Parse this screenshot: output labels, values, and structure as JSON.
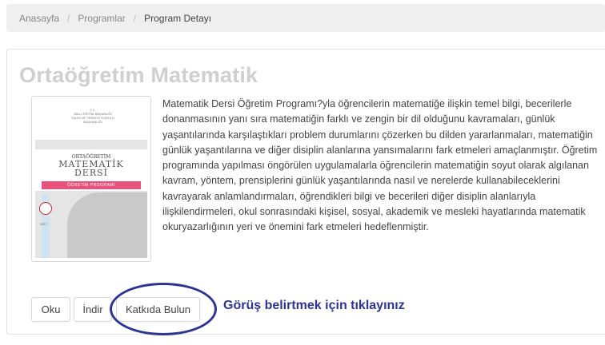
{
  "breadcrumb": {
    "items": [
      "Anasayfa",
      "Programlar"
    ],
    "active": "Program Detayı",
    "separator": "/"
  },
  "program": {
    "title": "Ortaöğretim Matematik",
    "description": "Matematik Dersi Öğretim Programı?yla öğrencilerin matematiğe ilişkin temel bilgi, becerilerle donanmasının yanı sıra matematiğin farklı ve zengin bir dil olduğunu kavramaları, günlük yaşantılarında karşılaştıkları problem durumlarını çözerken bu dilden yararlanmaları, matematiğin günlük yaşantılarına ve diğer disiplin alanlarına yansımalarını fark etmeleri amaçlanmıştır. Öğretim programında yapılması öngörülen uygulamalarla öğrencilerin matematiğin soyut olarak algılanan kavram, yöntem, prensiplerini günlük yaşantılarında nasıl ve nerelerde kullanabileceklerini kavrayarak anlamlandırmaları, öğrendikleri bilgi ve becerileri diğer disiplin alanlarıyla ilişkilendirmeleri, okul sonrasındaki kişisel, sosyal, akademik ve mesleki hayatlarında matematik okuryazarlığının yeri ve önemini fark etmeleri hedeflenmiştir.",
    "cover": {
      "top_text": "T.C.\nMİLLİ EĞİTİM BAKANLIĞI\nTALİM VE TERBİYE KURULU BAŞKANLIĞI",
      "subtitle": "ORTAÖĞRETİM",
      "main_line1": "MATEMATİK",
      "main_line2": "DERSİ",
      "pill": "ÖĞRETİM PROGRAMI",
      "year": "2017"
    }
  },
  "actions": {
    "read": "Oku",
    "download": "İndir",
    "contribute": "Katkıda Bulun"
  },
  "annotation": {
    "hint": "Görüş belirtmek için tıklayınız",
    "color": "#2e3591"
  }
}
